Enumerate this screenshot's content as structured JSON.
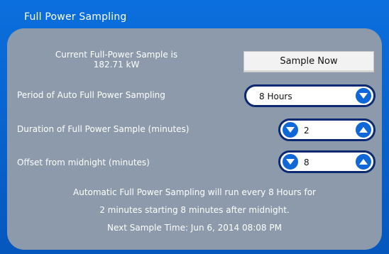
{
  "window": {
    "title": "Full Power Sampling"
  },
  "current_sample": {
    "label": "Current Full-Power Sample is",
    "value": "182.71 kW"
  },
  "sample_now_button": "Sample Now",
  "period": {
    "label": "Period of Auto Full Power Sampling",
    "value": "8 Hours"
  },
  "duration": {
    "label": "Duration of Full Power Sample (minutes)",
    "value": "2"
  },
  "offset": {
    "label": "Offset from midnight (minutes)",
    "value": "8"
  },
  "summary": {
    "line1": "Automatic Full Power Sampling will run every 8 Hours for",
    "line2": "2 minutes starting 8 minutes after midnight.",
    "line3": "Next Sample Time: Jun 6, 2014 08:08 PM"
  },
  "colors": {
    "header_blue": "#0a63c9",
    "panel_gray": "#8c9aab",
    "control_blue": "#1068d8",
    "control_border": "#0b2a72"
  },
  "icons": {
    "dropdown": "chevron-down-icon",
    "decrement": "chevron-down-icon",
    "increment": "chevron-up-icon"
  }
}
